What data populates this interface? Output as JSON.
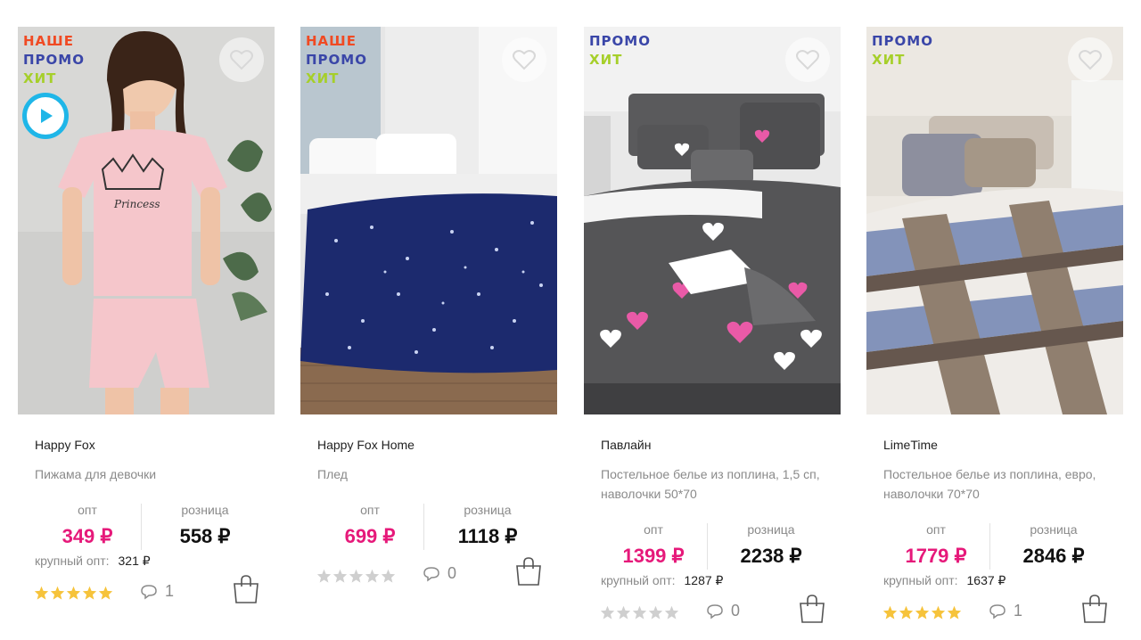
{
  "colors": {
    "promo_our": "#f04a23",
    "promo": "#3a46a8",
    "hit": "#a6cf2a",
    "price_opt": "#e6197a",
    "star_on": "#f6c33b",
    "star_off": "#cfcfcf"
  },
  "labels": {
    "opt": "опт",
    "retail": "розница",
    "bulk": "крупный опт:"
  },
  "products": [
    {
      "badges": [
        "НАШЕ",
        "ПРОМО",
        "ХИТ"
      ],
      "has_video": true,
      "brand": "Happy Fox",
      "desc": "Пижама для девочки",
      "price_opt": "349 ₽",
      "price_retail": "558 ₽",
      "bulk_price": "321 ₽",
      "rating": 5,
      "comments": "1",
      "icons": [
        "heart-icon",
        "play-icon",
        "comment-icon",
        "bag-icon"
      ]
    },
    {
      "badges": [
        "НАШЕ",
        "ПРОМО",
        "ХИТ"
      ],
      "has_video": false,
      "brand": "Happy Fox Home",
      "desc": "Плед",
      "price_opt": "699 ₽",
      "price_retail": "1118 ₽",
      "bulk_price": "",
      "rating": 0,
      "comments": "0",
      "icons": [
        "heart-icon",
        "comment-icon",
        "bag-icon"
      ]
    },
    {
      "badges": [
        "ПРОМО",
        "ХИТ"
      ],
      "has_video": false,
      "brand": "Павлайн",
      "desc": "Постельное белье из поплина, 1,5 сп, наволочки 50*70",
      "price_opt": "1399 ₽",
      "price_retail": "2238 ₽",
      "bulk_price": "1287 ₽",
      "rating": 0,
      "comments": "0",
      "icons": [
        "heart-icon",
        "comment-icon",
        "bag-icon"
      ]
    },
    {
      "badges": [
        "ПРОМО",
        "ХИТ"
      ],
      "has_video": false,
      "brand": "LimeTime",
      "desc": "Постельное белье из поплина, евро, наволочки 70*70",
      "price_opt": "1779 ₽",
      "price_retail": "2846 ₽",
      "bulk_price": "1637 ₽",
      "rating": 5,
      "comments": "1",
      "icons": [
        "heart-icon",
        "comment-icon",
        "bag-icon"
      ]
    }
  ]
}
